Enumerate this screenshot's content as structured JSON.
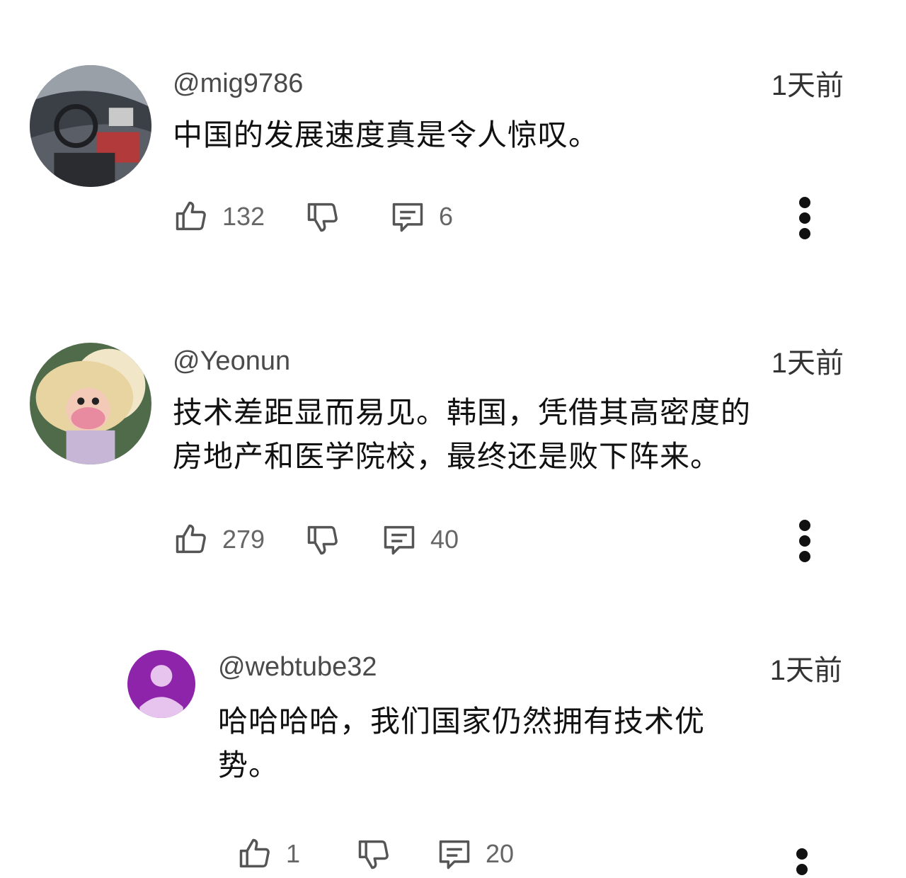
{
  "comments": [
    {
      "handle": "@mig9786",
      "time": "1天前",
      "text": "中国的发展速度真是令人惊叹。",
      "likes": "132",
      "replies": "6",
      "avatar_kind": "photo-car-interior"
    },
    {
      "handle": "@Yeonun",
      "time": "1天前",
      "text": "技术差距显而易见。韩国，凭借其高密度的\n房地产和医学院校，最终还是败下阵来。",
      "likes": "279",
      "replies": "40",
      "avatar_kind": "illustration-character-straw-hat"
    },
    {
      "handle": "@webtube32",
      "time": "1天前",
      "text": "哈哈哈哈，我们国家仍然拥有技术优\n势。",
      "likes": "1",
      "replies": "20",
      "avatar_kind": "default-person-purple",
      "avatar_color": "#8e24aa"
    }
  ],
  "icons": {
    "like": "thumbs-up-icon",
    "dislike": "thumbs-down-icon",
    "reply": "comment-bubble-icon",
    "more": "more-vert-icon"
  }
}
